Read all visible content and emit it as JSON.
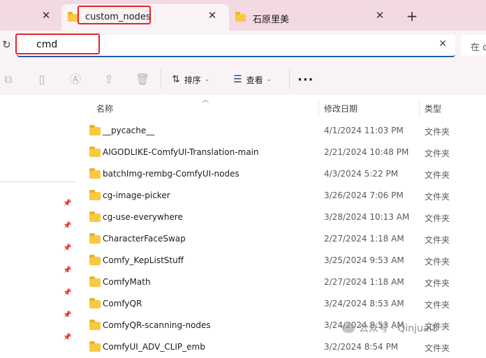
{
  "tabs": [
    {
      "title": "custom_nodes",
      "active": true
    },
    {
      "title": "石原里美",
      "active": false
    }
  ],
  "tabbar": {
    "new_tab_symbol": "+",
    "close_symbol": "✕"
  },
  "address": {
    "value": "cmd",
    "clear_symbol": "✕"
  },
  "search": {
    "placeholder": "在 c"
  },
  "toolbar": {
    "sort_label": "排序",
    "view_label": "查看",
    "more_label": "···"
  },
  "columns": {
    "name": "名称",
    "date": "修改日期",
    "type": "类型"
  },
  "files": [
    {
      "name": "__pycache__",
      "date": "4/1/2024 11:03 PM",
      "type": "文件夹"
    },
    {
      "name": "AIGODLIKE-ComfyUI-Translation-main",
      "date": "2/21/2024 10:48 PM",
      "type": "文件夹"
    },
    {
      "name": "batchImg-rembg-ComfyUI-nodes",
      "date": "4/3/2024 5:22 PM",
      "type": "文件夹"
    },
    {
      "name": "cg-image-picker",
      "date": "3/26/2024 7:06 PM",
      "type": "文件夹"
    },
    {
      "name": "cg-use-everywhere",
      "date": "3/28/2024 10:13 AM",
      "type": "文件夹"
    },
    {
      "name": "CharacterFaceSwap",
      "date": "2/27/2024 1:18 AM",
      "type": "文件夹"
    },
    {
      "name": "Comfy_KepListStuff",
      "date": "3/25/2024 9:53 AM",
      "type": "文件夹"
    },
    {
      "name": "ComfyMath",
      "date": "2/27/2024 1:18 AM",
      "type": "文件夹"
    },
    {
      "name": "ComfyQR",
      "date": "3/24/2024 8:53 AM",
      "type": "文件夹"
    },
    {
      "name": "ComfyQR-scanning-nodes",
      "date": "3/24/2024 8:53 AM",
      "type": "文件夹"
    },
    {
      "name": "ComfyUI_ADV_CLIP_emb",
      "date": "3/2/2024 8:54 PM",
      "type": "文件夹"
    }
  ],
  "watermark": {
    "text": "公众号 · Qinjuai8"
  },
  "colors": {
    "folder": "#f8c942",
    "highlight": "#e8222a",
    "accent": "#1a5fb4"
  }
}
